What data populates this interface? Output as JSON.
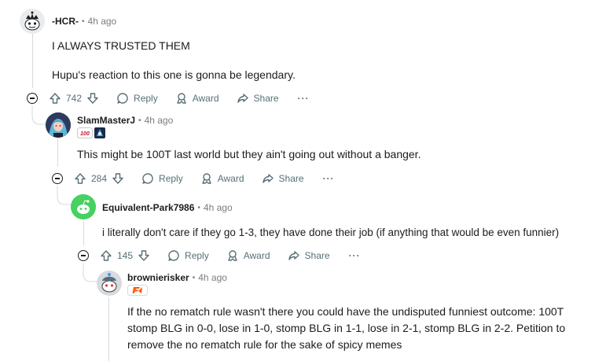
{
  "comments": [
    {
      "username": "-HCR-",
      "time": "4h ago",
      "paragraphs": [
        "I ALWAYS TRUSTED THEM",
        "Hupu's reaction to this one is gonna be legendary."
      ],
      "votes": "742",
      "reply_label": "Reply",
      "award_label": "Award",
      "share_label": "Share",
      "more_label": "···"
    },
    {
      "username": "SlamMasterJ",
      "time": "4h ago",
      "paragraphs": [
        "This might be 100T last world but they ain't going out without a banger."
      ],
      "votes": "284",
      "reply_label": "Reply",
      "award_label": "Award",
      "share_label": "Share",
      "more_label": "···"
    },
    {
      "username": "Equivalent-Park7986",
      "time": "4h ago",
      "paragraphs": [
        "i literally don't care if they go 1-3, they have done their job (if anything that would be even funnier)"
      ],
      "votes": "145",
      "reply_label": "Reply",
      "award_label": "Award",
      "share_label": "Share",
      "more_label": "···"
    },
    {
      "username": "brownierisker",
      "time": "4h ago",
      "paragraphs": [
        "If the no rematch rule wasn't there you could have the undisputed funniest outcome: 100T stomp BLG in 0-0, lose in 1-0, stomp BLG in 1-1, lose in 2-1, stomp BLG in 2-2. Petition to remove the no rematch rule for the sake of spicy memes"
      ]
    }
  ],
  "separator": "•",
  "colors": {
    "text": "#1c1c1c",
    "muted": "#576f76",
    "time": "#7c7c7c",
    "thread_line": "#d6d9dc",
    "green_avatar": "#46d160",
    "fnatic_orange": "#ff5900"
  }
}
